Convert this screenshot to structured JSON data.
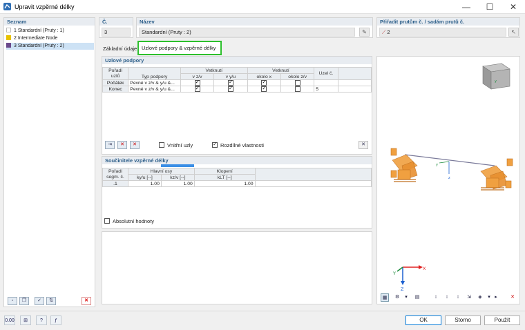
{
  "window": {
    "title": "Upravit vzpěrné délky",
    "minimize": "—",
    "maximize": "☐",
    "close": "✕"
  },
  "list": {
    "header": "Seznam",
    "items": [
      {
        "num": "1",
        "label": "Standardní (Pruty : 1)",
        "color": "#ffffff"
      },
      {
        "num": "2",
        "label": "Intermediate Node",
        "color": "#e8c200"
      },
      {
        "num": "3",
        "label": "Standardní (Pruty : 2)",
        "color": "#6b4a8c"
      }
    ]
  },
  "top": {
    "no_label": "Č.",
    "no_value": "3",
    "name_label": "Název",
    "name_value": "Standardní (Pruty : 2)",
    "assign_label": "Přiřadit prutům č. / sadám prutů č.",
    "assign_value": "2"
  },
  "tabs": [
    {
      "label": "Základní údaje"
    },
    {
      "label": "Uzlové podpory & vzpěrné délky"
    }
  ],
  "supports": {
    "header": "Uzlové podpory",
    "col_order": "Pořadí uzlů",
    "col_type": "Typ podpory",
    "grp_fix1": "Vetknutí",
    "col_vzv": "v z/v",
    "col_vyu": "v y/u",
    "grp_fix2": "Vetknutí",
    "col_okx": "okolo x",
    "col_okzv": "okolo z/v",
    "col_node": "Uzel č.",
    "rows": [
      {
        "order": "Počátek",
        "type": "Pevné v z/v & y/u &...",
        "vzv": true,
        "vyu": true,
        "okx": true,
        "okzv": false,
        "node": ""
      },
      {
        "order": "Konec",
        "type": "Pevné v z/v & y/u &...",
        "vzv": true,
        "vyu": true,
        "okx": true,
        "okzv": false,
        "node": "5"
      }
    ],
    "inner_nodes": "Vnitřní uzly",
    "diff_props": "Rozdílné vlastnosti"
  },
  "factors": {
    "header": "Součinitele vzpěrné délky",
    "col_order": "Pořadí segm. č.",
    "grp_main": "Hlavní osy",
    "col_ky": "ky/u [--]",
    "col_kz": "kz/v [--]",
    "grp_lt": "Klopení",
    "col_klt": "kLT [--]",
    "rows": [
      {
        "order": ".1",
        "ky": "1.00",
        "kz": "1.00",
        "klt": "1.00"
      }
    ],
    "abs_values": "Absolutní hodnoty"
  },
  "view": {
    "axis_x": "X",
    "axis_y": "Y",
    "axis_z": "Z",
    "local_y": "y",
    "local_z": "z"
  },
  "footer": {
    "ok": "OK",
    "cancel": "Storno",
    "apply": "Použít",
    "units": "0.00"
  },
  "colors": {
    "accent_green": "#2dc02d",
    "support_orange": "#f0a040",
    "header_blue": "#2d5f8a"
  }
}
